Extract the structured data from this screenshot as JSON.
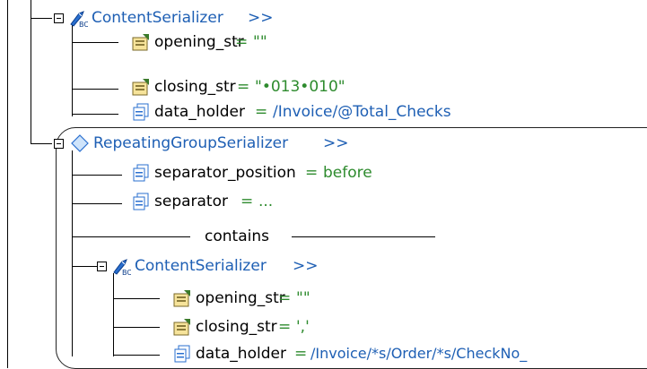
{
  "tree": {
    "content_serializer_1": {
      "name": "ContentSerializer",
      "arrow": ">>"
    },
    "opening_1": {
      "name": "opening_str",
      "eq": "=",
      "value": "\"\""
    },
    "closing_1": {
      "name": "closing_str",
      "eq": "=",
      "value": "\"•013•010\""
    },
    "data_holder_1": {
      "name": "data_holder",
      "eq": "=",
      "value": "/Invoice/@Total_Checks"
    },
    "repeating": {
      "name": "RepeatingGroupSerializer",
      "arrow": ">>"
    },
    "separator_position": {
      "name": "separator_position",
      "eq": "=",
      "value": "before"
    },
    "separator": {
      "name": "separator",
      "eq": "=",
      "value": "..."
    },
    "contains": "contains",
    "content_serializer_2": {
      "name": "ContentSerializer",
      "arrow": ">>"
    },
    "opening_2": {
      "name": "opening_str",
      "eq": "=",
      "value": "\"\""
    },
    "closing_2": {
      "name": "closing_str",
      "eq": "=",
      "value": "','"
    },
    "data_holder_2": {
      "name": "data_holder",
      "eq": "=",
      "value": "/Invoice/*s/Order/*s/CheckNo_"
    }
  },
  "icons": {
    "serializer": "content-serializer-icon",
    "repeating": "repeating-group-icon",
    "string_prop": "string-property-icon",
    "data_prop": "data-property-icon"
  },
  "colors": {
    "blue": "#1e5fb4",
    "green": "#2e8b2e"
  }
}
